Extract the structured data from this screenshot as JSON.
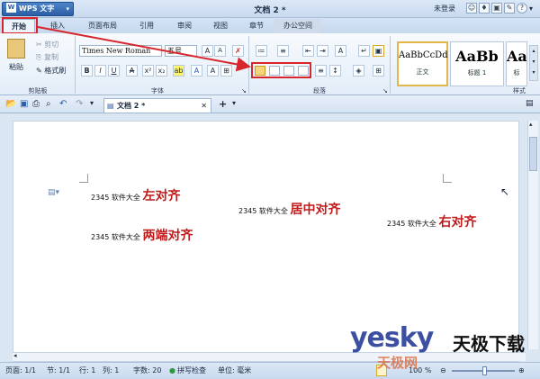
{
  "app": {
    "name": "WPS 文字",
    "logo_letter": "W"
  },
  "window": {
    "title": "文档 2 *",
    "login": "未登录"
  },
  "tabs": [
    "开始",
    "插入",
    "页面布局",
    "引用",
    "审阅",
    "视图",
    "章节",
    "办公空间"
  ],
  "active_tab": "开始",
  "clipboard": {
    "paste": "粘贴",
    "cut": "剪切",
    "copy": "复制",
    "format_painter": "格式刷",
    "group": "剪贴板"
  },
  "font": {
    "name": "Times New Roman",
    "size": "五号",
    "group": "字体"
  },
  "paragraph": {
    "group": "段落"
  },
  "styles": {
    "group": "样式",
    "items": [
      {
        "sample": "AaBbCcDd",
        "name": "正文"
      },
      {
        "sample": "AaBb",
        "name": "标题 1"
      },
      {
        "sample": "Aa",
        "name": "标"
      }
    ]
  },
  "doc_tab": {
    "label": "文档 2 *"
  },
  "document": {
    "lines": [
      {
        "prefix": "2345 软件大全",
        "text": "左对齐"
      },
      {
        "prefix": "2345 软件大全",
        "text": "居中对齐"
      },
      {
        "prefix": "2345 软件大全",
        "text": "右对齐"
      },
      {
        "prefix": "2345 软件大全",
        "text": "两端对齐"
      }
    ]
  },
  "status": {
    "page": "页面: 1/1",
    "section": "节: 1/1",
    "row": "行: 1",
    "col": "列: 1",
    "words": "字数: 20",
    "spell": "拼写检查",
    "unit": "单位: 毫米",
    "zoom": "100 %"
  },
  "watermark": {
    "brand": "yesky",
    "cn": "天极下载",
    "sub": "天极网"
  },
  "colors": {
    "accent_red": "#d8252b",
    "heading_red": "#c21a1a",
    "brand_blue": "#2c5fa5"
  }
}
